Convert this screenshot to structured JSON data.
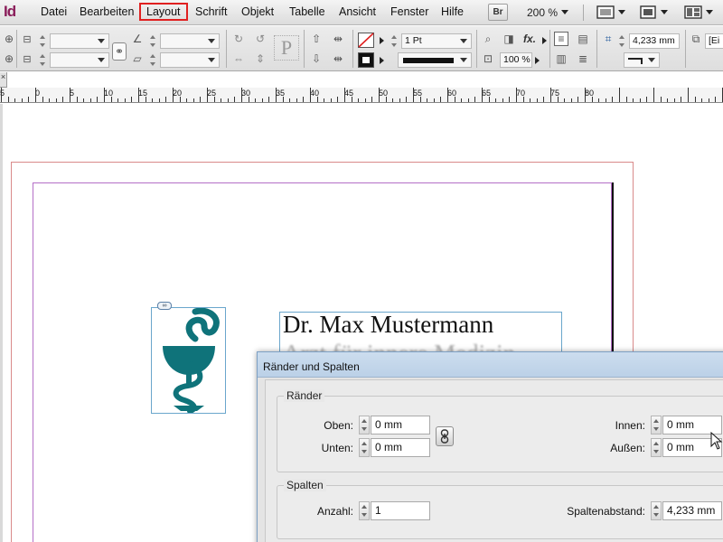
{
  "app": {
    "logo_text": "Id"
  },
  "menu": {
    "items": [
      "Datei",
      "Bearbeiten",
      "Layout",
      "Schrift",
      "Objekt",
      "Tabelle",
      "Ansicht",
      "Fenster",
      "Hilfe"
    ],
    "bridge_label": "Br",
    "zoom": "200 %"
  },
  "control_panel": {
    "stroke_weight": "1 Pt",
    "opacity": "100 %",
    "offset_value": "4,233 mm",
    "style_label": "[Ei"
  },
  "ruler": {
    "labels": [
      "5",
      "0",
      "5",
      "10",
      "15",
      "20",
      "25",
      "30",
      "35",
      "40",
      "45",
      "50",
      "55",
      "60",
      "65",
      "70",
      "75",
      "80"
    ]
  },
  "document": {
    "line1": "Dr. Max Mustermann",
    "line2": "Arzt für innere Medizin"
  },
  "dialog": {
    "title": "Ränder und Spalten",
    "margins_group": "Ränder",
    "top_label": "Oben:",
    "top_value": "0 mm",
    "bottom_label": "Unten:",
    "bottom_value": "0 mm",
    "inside_label": "Innen:",
    "inside_value": "0 mm",
    "outside_label": "Außen:",
    "outside_value": "0 mm",
    "columns_group": "Spalten",
    "count_label": "Anzahl:",
    "count_value": "1",
    "gutter_label": "Spaltenabstand:",
    "gutter_value": "4,233 mm"
  },
  "colors": {
    "logo_teal": "#0f737a",
    "highlight_red": "#e02020",
    "margin_guide": "#b46fc7",
    "bleed_guide": "#d98a8a"
  }
}
